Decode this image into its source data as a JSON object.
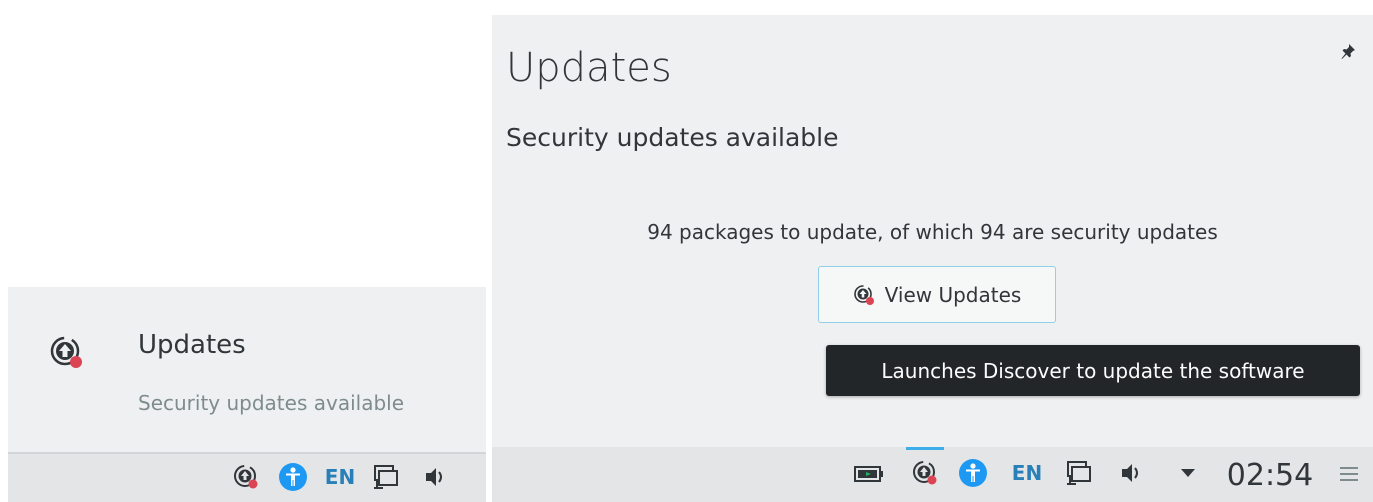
{
  "left": {
    "title": "Updates",
    "subtitle": "Security updates available",
    "tray": {
      "lang": "EN"
    }
  },
  "right": {
    "title": "Updates",
    "subtitle": "Security updates available",
    "summary": "94 packages to update, of which 94 are security updates",
    "button_label": "View Updates",
    "tooltip": "Launches Discover to update the software",
    "tray": {
      "lang": "EN",
      "clock": "02:54"
    }
  },
  "colors": {
    "accent": "#3daee9",
    "badge": "#da4453",
    "popup_bg": "#eff0f1",
    "panel_bg": "#e3e5e7",
    "tooltip_bg": "#232629"
  },
  "icons": [
    "update-icon",
    "accessibility-icon",
    "network-icon",
    "volume-icon",
    "battery-icon",
    "pin-icon",
    "expand-arrow-icon",
    "hamburger-menu-icon"
  ]
}
